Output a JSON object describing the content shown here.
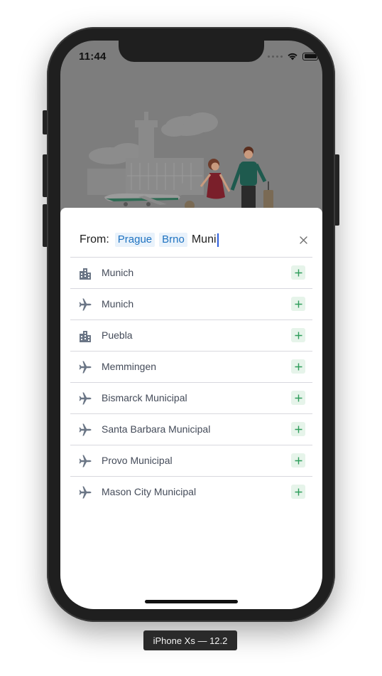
{
  "status_bar": {
    "time": "11:44"
  },
  "search": {
    "from_label": "From:",
    "selected_chips": [
      "Prague",
      "Brno"
    ],
    "typed_text": "Muni",
    "clear_icon": "close-icon"
  },
  "results": [
    {
      "label": "Munich",
      "icon": "city-icon"
    },
    {
      "label": "Munich",
      "icon": "airplane-icon"
    },
    {
      "label": "Puebla",
      "icon": "city-icon"
    },
    {
      "label": "Memmingen",
      "icon": "airplane-icon"
    },
    {
      "label": "Bismarck Municipal",
      "icon": "airplane-icon"
    },
    {
      "label": "Santa Barbara Municipal",
      "icon": "airplane-icon"
    },
    {
      "label": "Provo Municipal",
      "icon": "airplane-icon"
    },
    {
      "label": "Mason City Municipal",
      "icon": "airplane-icon"
    }
  ],
  "device_label": "iPhone Xs — 12.2",
  "colors": {
    "chip_text": "#1f73c1",
    "chip_background": "#e9f2fb",
    "add_icon": "#2e9d5b",
    "add_background": "#e6f4ea",
    "icon_gray": "#6b7686"
  }
}
